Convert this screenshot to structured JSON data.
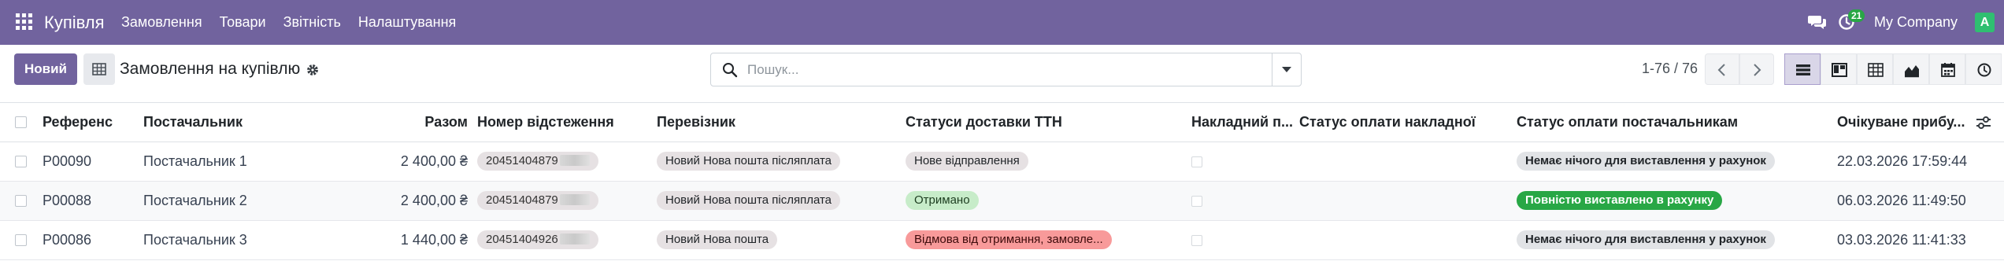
{
  "navbar": {
    "brand": "Купівля",
    "menu": [
      "Замовлення",
      "Товари",
      "Звітність",
      "Налаштування"
    ],
    "activity_count": "21",
    "company": "My Company",
    "avatar_letter": "A",
    "icons": [
      "apps-grid-icon",
      "chat-icon",
      "activity-clock-icon"
    ]
  },
  "control_panel": {
    "new_button": "Новий",
    "breadcrumb": "Замовлення на купівлю",
    "search_placeholder": "Пошук...",
    "pager": "1-76 / 76",
    "views": [
      "list-view-icon",
      "kanban-view-icon",
      "pivot-view-icon",
      "graph-view-icon",
      "calendar-view-icon",
      "activity-view-icon"
    ]
  },
  "table": {
    "headers": {
      "reference": "Референс",
      "vendor": "Постачальник",
      "total": "Разом",
      "tracking": "Номер відстеження",
      "carrier": "Перевізник",
      "delivery_status": "Статуси доставки ТТН",
      "invoice_flag": "Накладний п...",
      "invoice_payment_status": "Статус оплати накладної",
      "vendor_payment_status": "Статус оплати постачальникам",
      "expected": "Очікуване прибу..."
    },
    "rows": [
      {
        "reference": "P00090",
        "vendor": "Постачальник 1",
        "total": "2 400,00 ₴",
        "tracking": "20451404879",
        "carrier": "Новий Нова пошта післяплата",
        "delivery_status": "Нове відправлення",
        "vendor_payment_status": "Немає нічого для виставлення у рахунок",
        "expected": "22.03.2026 17:59:44"
      },
      {
        "reference": "P00088",
        "vendor": "Постачальник 2",
        "total": "2 400,00 ₴",
        "tracking": "20451404879",
        "carrier": "Новий Нова пошта післяплата",
        "delivery_status": "Отримано",
        "vendor_payment_status": "Повністю виставлено в рахунку",
        "expected": "06.03.2026 11:49:50"
      },
      {
        "reference": "P00086",
        "vendor": "Постачальник 3",
        "total": "1 440,00 ₴",
        "tracking": "20451404926",
        "carrier": "Новий Нова пошта",
        "delivery_status": "Відмова від отримання, замовле...",
        "vendor_payment_status": "Немає нічого для виставлення у рахунок",
        "expected": "03.03.2026 11:41:33"
      }
    ]
  },
  "colors": {
    "navbar": "#71639e",
    "primary": "#71639e",
    "success": "#28a745",
    "danger_badge": "#f89a9a",
    "success_light_badge": "#c7ecc9"
  }
}
